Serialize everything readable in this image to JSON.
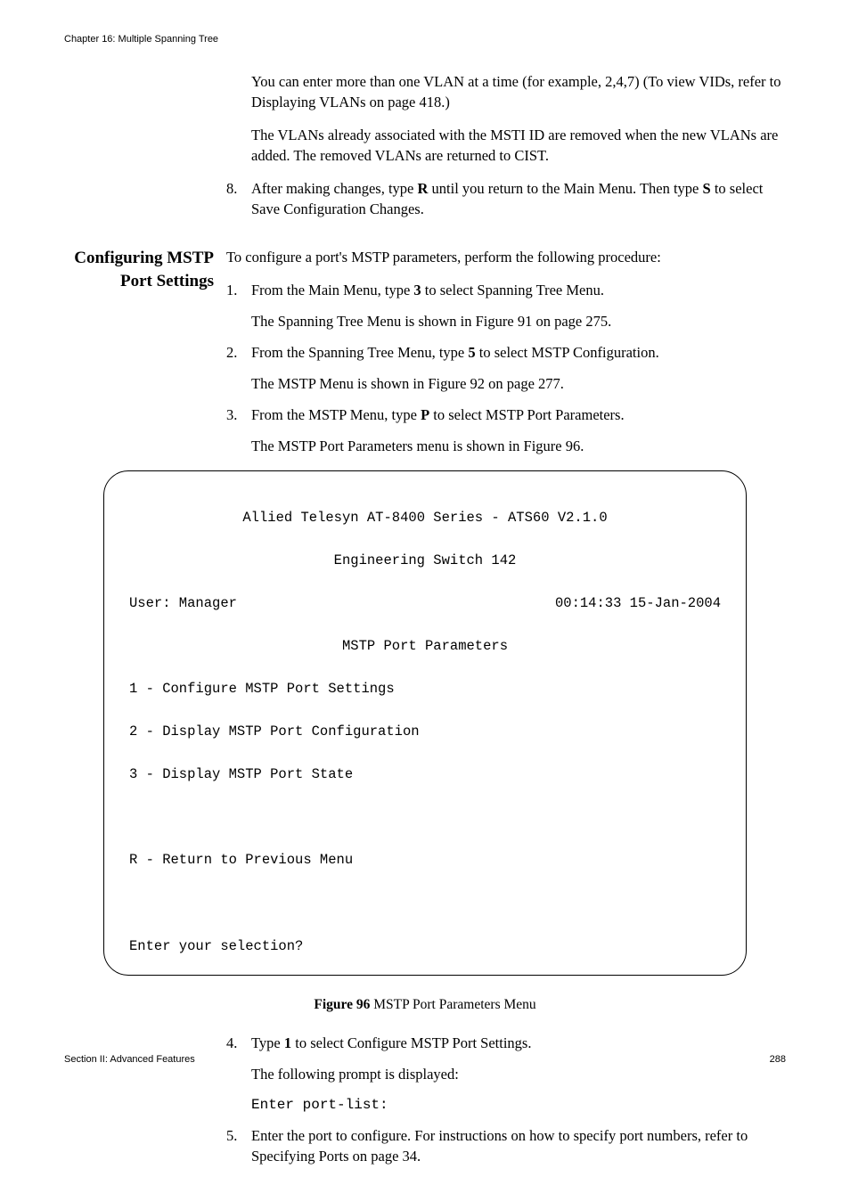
{
  "header": "Chapter 16: Multiple Spanning Tree",
  "footer_left": "Section II: Advanced Features",
  "footer_right": "288",
  "intro": {
    "p1": "You can enter more than one VLAN at a time (for example, 2,4,7) (To view VIDs, refer to Displaying VLANs on page 418.)",
    "p2": "The VLANs already associated with the MSTI ID are removed when the new VLANs are added. The removed VLANs are returned to CIST.",
    "step8_num": "8.",
    "step8_a": "After making changes, type ",
    "step8_b": "R",
    "step8_c": " until you return to the Main Menu. Then type ",
    "step8_d": "S",
    "step8_e": " to select Save Configuration Changes."
  },
  "section_heading": "Configuring MSTP Port Settings",
  "section_intro": "To configure a port's MSTP parameters, perform the following procedure:",
  "steps": {
    "s1_num": "1.",
    "s1_a": "From the Main Menu, type ",
    "s1_b": "3",
    "s1_c": " to select Spanning Tree Menu.",
    "s1_sub": "The Spanning Tree Menu is shown in Figure 91 on page 275.",
    "s2_num": "2.",
    "s2_a": "From the Spanning Tree Menu, type ",
    "s2_b": "5",
    "s2_c": " to select MSTP Configuration.",
    "s2_sub": "The MSTP Menu is shown in Figure 92 on page 277.",
    "s3_num": "3.",
    "s3_a": "From the MSTP Menu, type ",
    "s3_b": "P",
    "s3_c": " to select MSTP Port Parameters.",
    "s3_sub": "The MSTP Port Parameters menu is shown in Figure 96.",
    "s4_num": "4.",
    "s4_a": "Type ",
    "s4_b": "1",
    "s4_c": " to select Configure MSTP Port Settings.",
    "s4_sub1": "The following prompt is displayed:",
    "s4_mono": "Enter port-list:",
    "s5_num": "5.",
    "s5_text": "Enter the port to configure. For instructions on how to specify port numbers, refer to Specifying Ports on page 34."
  },
  "terminal": {
    "title1": "Allied Telesyn AT-8400 Series - ATS60 V2.1.0",
    "title2": "Engineering Switch 142",
    "user": "User: Manager",
    "datetime": "00:14:33 15-Jan-2004",
    "menu_title": "MSTP Port Parameters",
    "opt1": "1 - Configure MSTP Port Settings",
    "opt2": "2 - Display MSTP Port Configuration",
    "opt3": "3 - Display MSTP Port State",
    "optR": "R - Return to Previous Menu",
    "prompt": "Enter your selection?"
  },
  "figure_caption_bold": "Figure 96",
  "figure_caption_rest": "  MSTP Port Parameters Menu"
}
